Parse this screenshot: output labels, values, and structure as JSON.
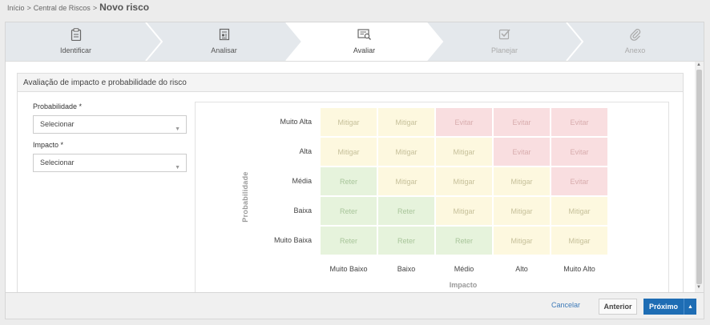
{
  "breadcrumb": {
    "home": "Início",
    "sep1": ">",
    "section": "Central de Riscos",
    "sep2": ">",
    "current": "Novo risco"
  },
  "steps": [
    {
      "label": "Identificar",
      "icon": "clipboard-icon",
      "state": "done"
    },
    {
      "label": "Analisar",
      "icon": "document-icon",
      "state": "done"
    },
    {
      "label": "Avaliar",
      "icon": "form-search-icon",
      "state": "active"
    },
    {
      "label": "Planejar",
      "icon": "checkbox-icon",
      "state": "disabled"
    },
    {
      "label": "Anexo",
      "icon": "paperclip-icon",
      "state": "disabled"
    }
  ],
  "panel": {
    "title": "Avaliação de impacto e probabilidade do risco"
  },
  "form": {
    "probabilidade": {
      "label": "Probabilidade *",
      "value": "Selecionar"
    },
    "impacto": {
      "label": "Impacto *",
      "value": "Selecionar"
    }
  },
  "matrix": {
    "y_title": "Probabilidade",
    "x_title": "Impacto",
    "rows": [
      "Muito Alta",
      "Alta",
      "Média",
      "Baixa",
      "Muito Baixa"
    ],
    "cols": [
      "Muito Baixo",
      "Baixo",
      "Médio",
      "Alto",
      "Muito Alto"
    ],
    "cells": [
      [
        "Mitigar",
        "Mitigar",
        "Evitar",
        "Evitar",
        "Evitar"
      ],
      [
        "Mitigar",
        "Mitigar",
        "Mitigar",
        "Evitar",
        "Evitar"
      ],
      [
        "Reter",
        "Mitigar",
        "Mitigar",
        "Mitigar",
        "Evitar"
      ],
      [
        "Reter",
        "Reter",
        "Mitigar",
        "Mitigar",
        "Mitigar"
      ],
      [
        "Reter",
        "Reter",
        "Reter",
        "Mitigar",
        "Mitigar"
      ]
    ]
  },
  "footer": {
    "cancel": "Cancelar",
    "previous": "Anterior",
    "next": "Próximo",
    "next_arrow": "▲"
  },
  "colors": {
    "primary": "#1e6db4",
    "mitigar": "#fdf8df",
    "evitar": "#f9dee0",
    "reter": "#e6f3dc"
  }
}
